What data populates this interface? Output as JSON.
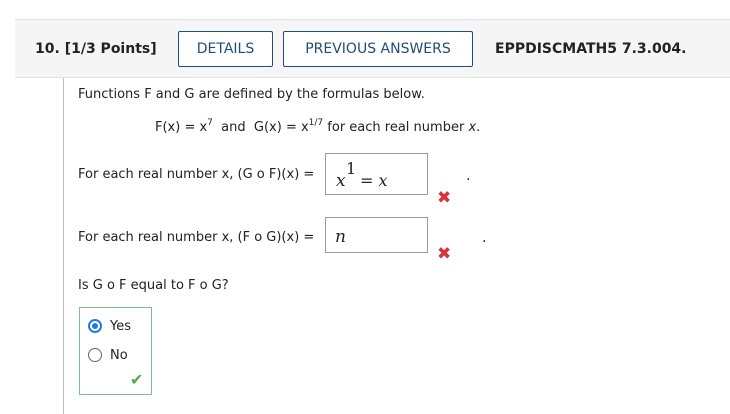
{
  "header": {
    "question_number": "10.",
    "points": "[1/3 Points]",
    "details_label": "DETAILS",
    "previous_answers_label": "PREVIOUS ANSWERS",
    "question_code": "EPPDISCMATH5 7.3.004."
  },
  "problem": {
    "intro": "Functions F and G are defined by the formulas below.",
    "formula": {
      "f_lhs": "F(x) = x",
      "f_exp": "7",
      "and": "and",
      "g_lhs": "G(x) = x",
      "g_exp": "1/7",
      "tail": "for each real number",
      "var": "x",
      "period": "."
    }
  },
  "part1": {
    "prompt": "For each real number x, (G o F)(x) =",
    "answer_base": "x",
    "answer_exp": "1",
    "answer_rest": "= x",
    "status_icon": "incorrect-x-icon",
    "period": "."
  },
  "part2": {
    "prompt": "For each real number x, (F o G)(x) =",
    "answer": "n",
    "status_icon": "incorrect-x-icon",
    "period": "."
  },
  "part3": {
    "prompt": "Is G o F equal to F o G?",
    "options": [
      {
        "label": "Yes",
        "selected": true
      },
      {
        "label": "No",
        "selected": false
      }
    ],
    "status_icon": "correct-check-icon"
  },
  "colors": {
    "button_border": "#1f4d7a",
    "incorrect": "#d6343d",
    "correct": "#4caf50",
    "radio_selected": "#1f7ae0"
  }
}
